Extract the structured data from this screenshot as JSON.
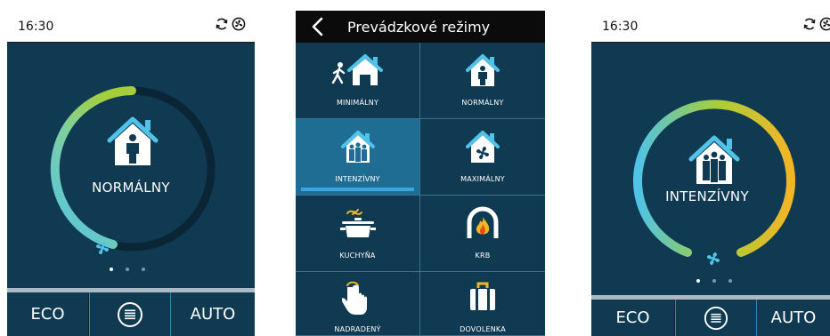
{
  "left_screen": {
    "time": "16:30",
    "mode_label": "NORMÁLNY",
    "bottom": {
      "eco_label": "ECO",
      "auto_label": "AUTO"
    },
    "page_indicator": {
      "count": 3,
      "active": 0
    }
  },
  "mode_menu": {
    "title": "Prevádzkové režimy",
    "items": [
      {
        "label": "MINIMÁLNY",
        "icon": "person-walking-house-icon",
        "selected": false
      },
      {
        "label": "NORMÁLNY",
        "icon": "house-person-icon",
        "selected": false
      },
      {
        "label": "INTENZÍVNY",
        "icon": "house-group-icon",
        "selected": true
      },
      {
        "label": "MAXIMÁLNY",
        "icon": "house-fan-icon",
        "selected": false
      },
      {
        "label": "KUCHYŇA",
        "icon": "cooking-pot-icon",
        "selected": false
      },
      {
        "label": "KRB",
        "icon": "fireplace-icon",
        "selected": false
      },
      {
        "label": "NADRADENÝ",
        "icon": "touch-hand-icon",
        "selected": false
      },
      {
        "label": "DOVOLENKA",
        "icon": "suitcase-icon",
        "selected": false
      }
    ]
  },
  "right_screen": {
    "time": "16:30",
    "mode_label": "INTENZÍVNY",
    "bottom": {
      "eco_label": "ECO",
      "auto_label": "AUTO"
    },
    "page_indicator": {
      "count": 3,
      "active": 0
    }
  },
  "colors": {
    "panel_bg": "#0f3a52",
    "selected_tile": "#1f6d93",
    "accent_blue": "#39a6e0",
    "ring_track": "#0a2536",
    "gradient_start": "#4fc3e8",
    "gradient_mid": "#a5cf3a",
    "gradient_end": "#f2b526"
  }
}
